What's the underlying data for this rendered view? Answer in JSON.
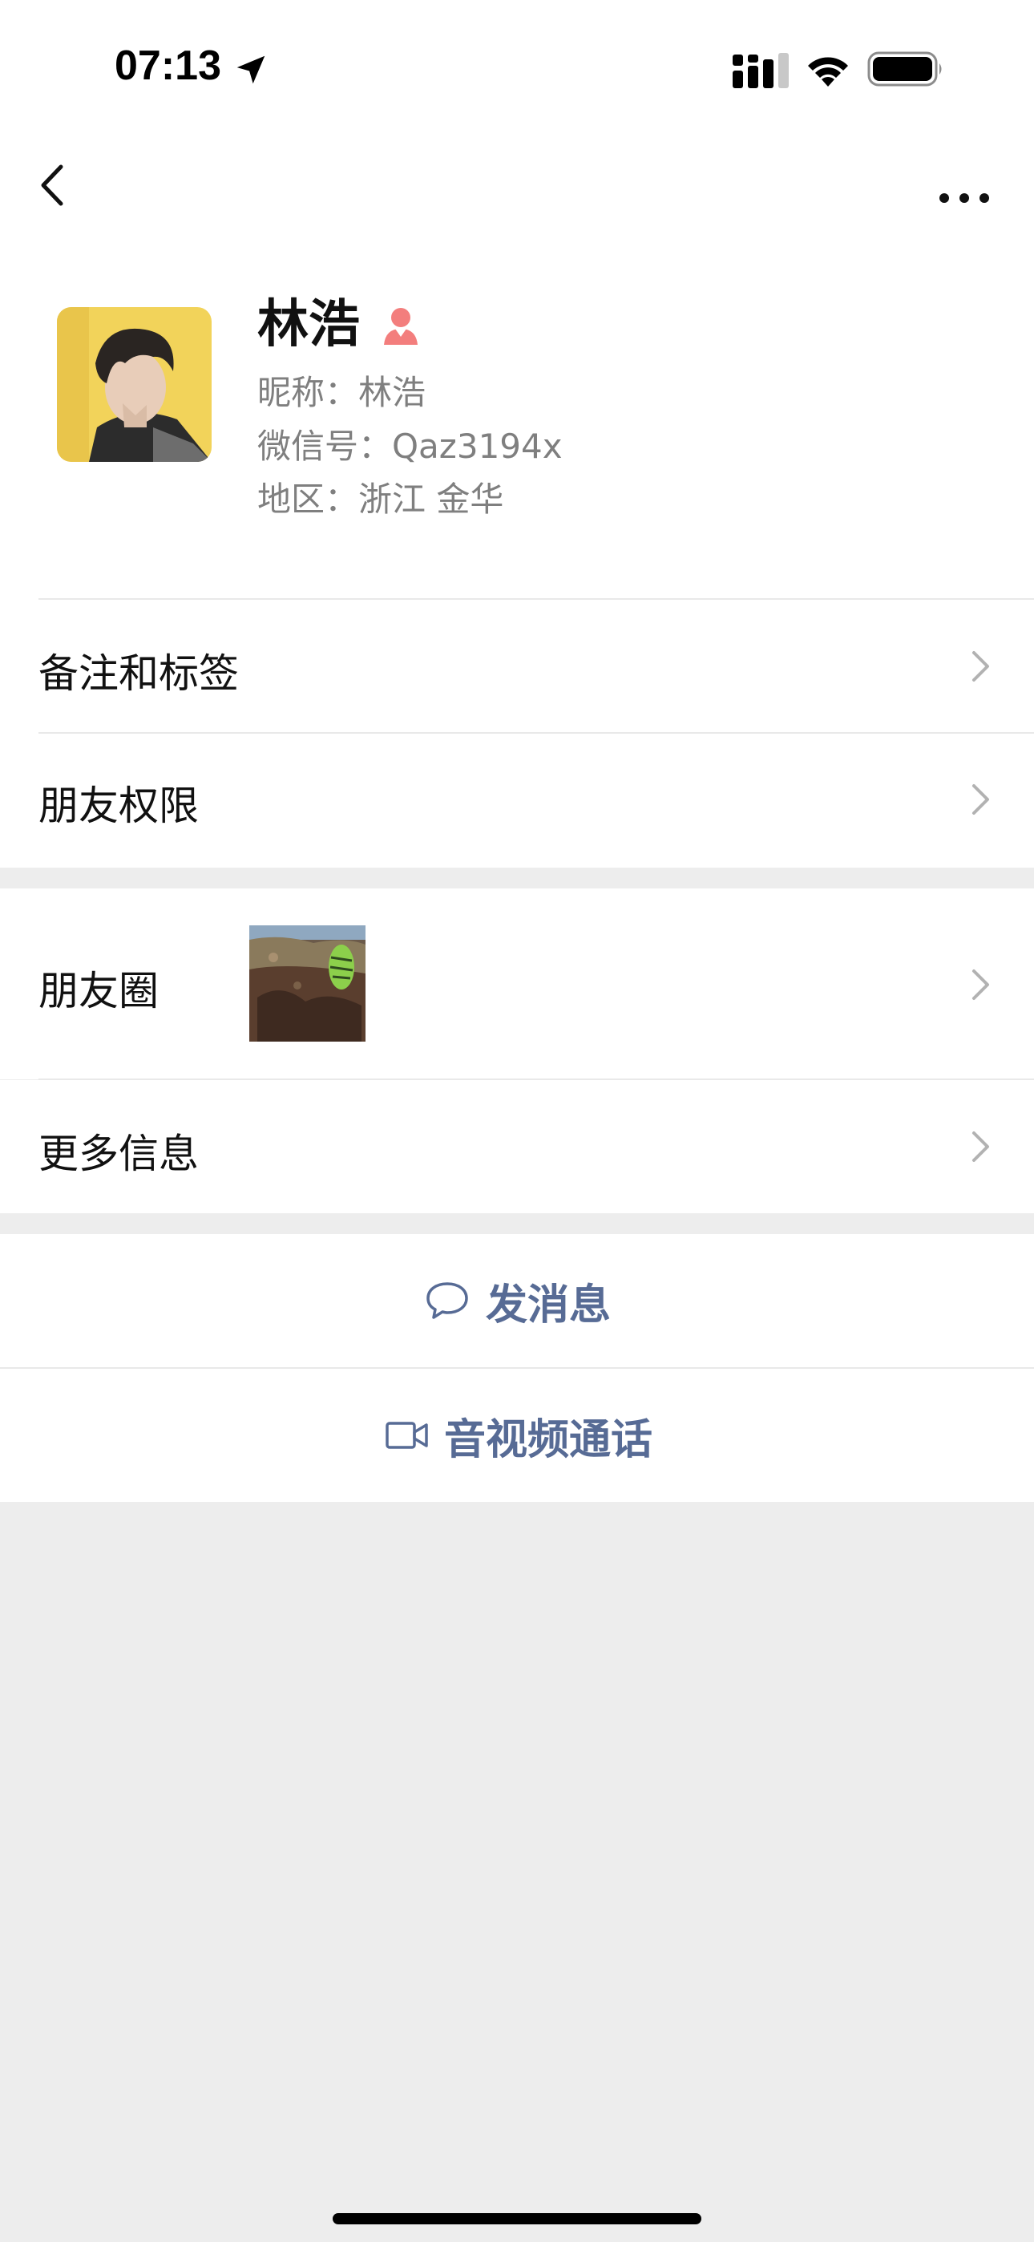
{
  "status_bar": {
    "time": "07:13",
    "icons": [
      "location-arrow-icon",
      "cellular-signal-icon",
      "wifi-icon",
      "battery-icon"
    ]
  },
  "nav": {
    "back_icon": "chevron-left-icon",
    "more_icon": "ellipsis-icon"
  },
  "profile": {
    "name": "林浩",
    "gender_icon": "female-icon",
    "gender_color": "#f37e7d",
    "nickname": "昵称：林浩",
    "wechat_id": "微信号：Qaz3194x",
    "region": "地区：浙江 金华"
  },
  "rows": {
    "remarks_tags": "备注和标签",
    "friend_permissions": "朋友权限",
    "moments": "朋友圈",
    "more_info": "更多信息"
  },
  "actions": {
    "send_message": "发消息",
    "av_call": "音视频通话"
  },
  "colors": {
    "accent": "#576b95",
    "background": "#ededed",
    "surface": "#ffffff"
  }
}
